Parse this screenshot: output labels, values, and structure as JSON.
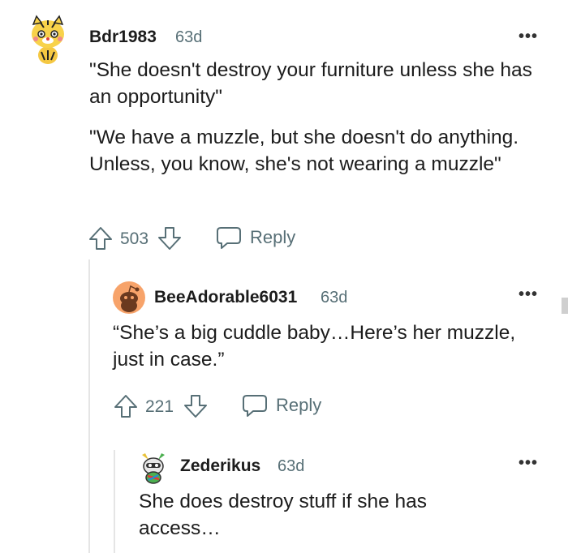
{
  "comments": [
    {
      "username": "Bdr1983",
      "time": "63d",
      "paragraphs": [
        "\"She doesn't destroy your furniture unless she has an opportunity\"",
        "\"We have a muzzle, but she doesn't do anything. Unless, you know, she's not wearing a muzzle\""
      ],
      "votes": "503",
      "reply_label": "Reply",
      "avatar_icon": "tiger-avatar-icon"
    },
    {
      "username": "BeeAdorable6031",
      "time": "63d",
      "paragraphs": [
        "“She’s a big cuddle baby…Here’s her muzzle, just in case.”"
      ],
      "votes": "221",
      "reply_label": "Reply",
      "avatar_icon": "snoo-avatar-icon"
    },
    {
      "username": "Zederikus",
      "time": "63d",
      "paragraphs": [
        "She does destroy stuff if she has access…"
      ],
      "avatar_icon": "snoo-badge-avatar-icon"
    }
  ],
  "more_label": "•••",
  "colors": {
    "text": "#1c1c1c",
    "meta": "#576f76",
    "thread_line": "#e5e5e5",
    "avatar_orange": "#f7a36a"
  }
}
